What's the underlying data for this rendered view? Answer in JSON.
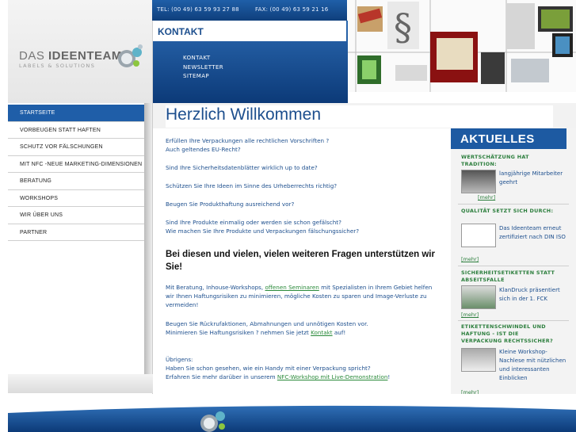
{
  "header": {
    "tel": "TEL: (00 49) 63 59 93 27 88",
    "fax": "FAX: (00 49) 63 59 21 16",
    "section_title": "KONTAKT",
    "links": [
      "KONTAKT",
      "NEWSLETTER",
      "SITEMAP"
    ]
  },
  "logo": {
    "name_light": "DAS ",
    "name_bold": "IDEENTEAM",
    "tagline": "LABELS & SOLUTIONS"
  },
  "nav": {
    "items": [
      {
        "label": "STARTSEITE",
        "active": true
      },
      {
        "label": "VORBEUGEN STATT HAFTEN"
      },
      {
        "label": "SCHUTZ VOR FÄLSCHUNGEN"
      },
      {
        "label": "MIT NFC -NEUE MARKETING-DIMENSIONEN"
      },
      {
        "label": "BERATUNG"
      },
      {
        "label": "WORKSHOPS"
      },
      {
        "label": "WIR ÜBER UNS"
      },
      {
        "label": "PARTNER"
      }
    ]
  },
  "main": {
    "heading": "Herzlich Willkommen",
    "questions": [
      "Erfüllen Ihre Verpackungen alle rechtlichen Vorschriften ?",
      "Auch geltendes EU-Recht?",
      "Sind Ihre Sicherheitsdatenblätter wirklich up to date?",
      "Schützen Sie Ihre Ideen im Sinne des Urheberrechts richtig?",
      "Beugen Sie Produkthaftung ausreichend vor?",
      "Sind Ihre Produkte einmalig oder werden sie schon gefälscht?",
      "Wie machen Sie Ihre Produkte und Verpackungen fälschungssicher?"
    ],
    "bold_heading": "Bei diesen und vielen, vielen weiteren Fragen unterstützen wir Sie!",
    "para1_before": "Mit Beratung, Inhouse-Workshops, ",
    "para1_link": "offenen Seminaren",
    "para1_after": " mit Spezialisten in Ihrem Gebiet helfen wir Ihnen Haftungsrisiken zu minimieren, mögliche Kosten zu sparen und Image-Verluste zu vermeiden!",
    "para2_line1": "Beugen Sie Rückrufaktionen, Abmahnungen und unnötigen Kosten vor.",
    "para2_before": "Minimieren Sie Haftungsrisiken ? nehmen Sie jetzt ",
    "para2_link": "Kontakt",
    "para2_after": " auf!",
    "para3_line1": "Übrigens:",
    "para3_line2": "Haben Sie schon gesehen, wie ein Handy mit einer Verpackung spricht?",
    "para3_before": "Erfahren Sie mehr darüber in unserem ",
    "para3_link": "NFC-Workshop mit Live-Demonstration",
    "para3_after": "!"
  },
  "aktuelles": {
    "title": "AKTUELLES",
    "more_label": "[mehr]",
    "items": [
      {
        "title": "WERTSCHÄTZUNG HAT TRADITION:",
        "text": "langjährige Mitarbeiter geehrt"
      },
      {
        "title": "QUALITÄT SETZT SICH DURCH:",
        "text": "Das Ideenteam erneut zertifiziert nach DIN ISO"
      },
      {
        "title": "SICHERHEITSETIKETTEN STATT ABSEITSFALLE",
        "text": "KlanDruck präsentiert sich in der 1. FCK"
      },
      {
        "title": "ETIKETTENSCHWINDEL UND HAFTUNG - IST DIE VERPACKUNG RECHTSSICHER?",
        "text": "Kleine Workshop-Nachlese mit nützlichen und interessanten Einblicken"
      }
    ]
  },
  "colors": {
    "brand_blue": "#1d5aa2",
    "link_green": "#2b7e3c",
    "text_blue": "#1d4f8e"
  }
}
